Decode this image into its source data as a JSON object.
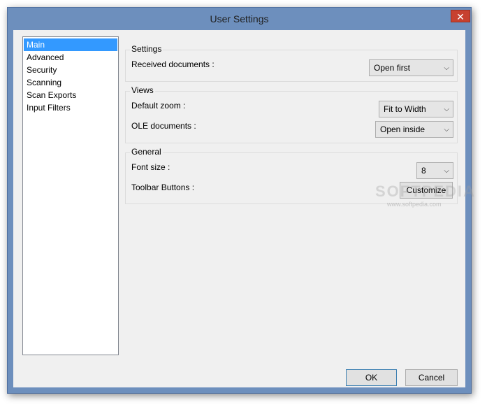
{
  "window": {
    "title": "User Settings",
    "close_glyph": "✕"
  },
  "nav": {
    "items": [
      {
        "label": "Main",
        "selected": true
      },
      {
        "label": "Advanced"
      },
      {
        "label": "Security"
      },
      {
        "label": "Scanning"
      },
      {
        "label": "Scan Exports"
      },
      {
        "label": "Input Filters"
      }
    ]
  },
  "settings": {
    "title": "Settings",
    "received_label": "Received documents :",
    "received_value": "Open first"
  },
  "views": {
    "title": "Views",
    "zoom_label": "Default zoom :",
    "zoom_value": "Fit to Width",
    "ole_label": "OLE documents :",
    "ole_value": "Open inside"
  },
  "general": {
    "title": "General",
    "font_label": "Font size :",
    "font_value": "8",
    "toolbar_label": "Toolbar Buttons :",
    "customize_label": "Customize"
  },
  "footer": {
    "ok_label": "OK",
    "cancel_label": "Cancel"
  },
  "watermark": {
    "text": "SOFTPEDIA",
    "sub": "www.softpedia.com"
  },
  "icons": {
    "dropdown": "chevron-down-icon",
    "close": "close-icon"
  },
  "colors": {
    "frame": "#6d8fbd",
    "close": "#c7412f",
    "selection": "#3399ff",
    "client": "#f0f0f0"
  }
}
